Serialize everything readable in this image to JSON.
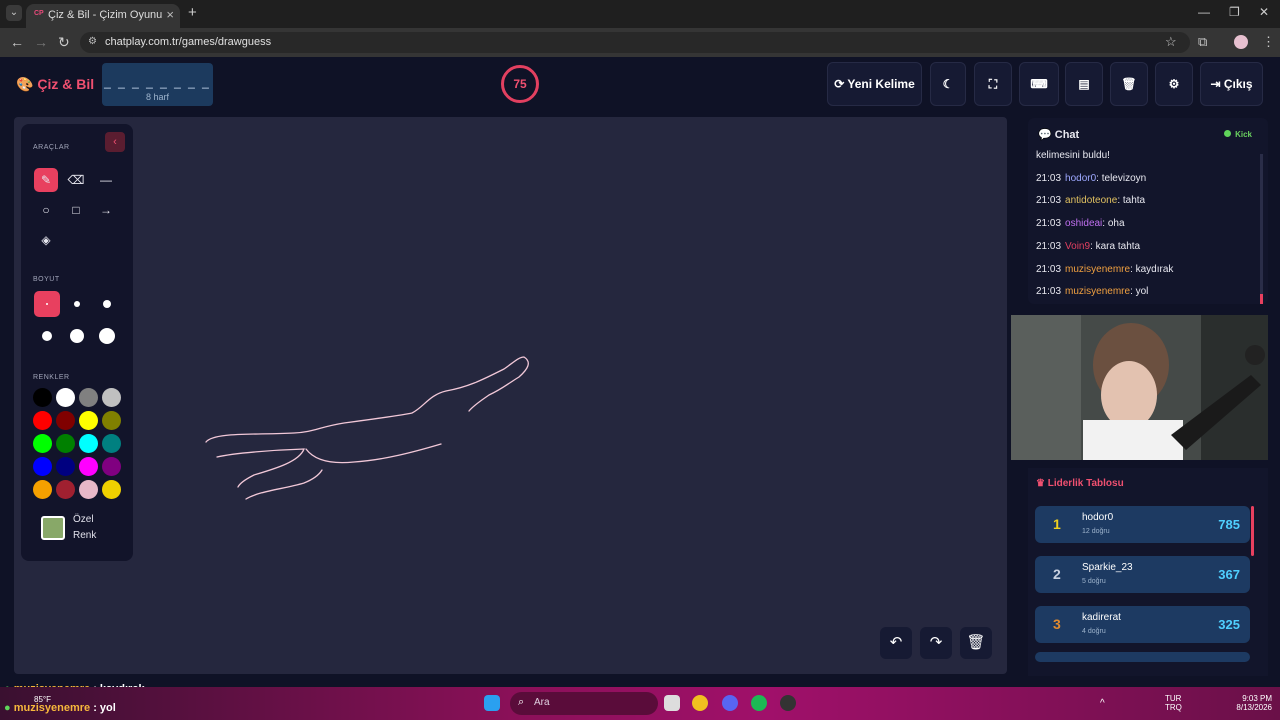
{
  "browser": {
    "tab_title": "Çiz & Bil - Çizim Oyunu",
    "tab_favicon": "CP",
    "url": "chatplay.com.tr/games/drawguess"
  },
  "header": {
    "logo": "Çiz & Bil",
    "word_dashes": "_ _ _ _ _ _ _ _",
    "word_count": "8 harf",
    "timer": "75",
    "new_word_label": "Yeni Kelime",
    "exit_label": "Çıkış"
  },
  "tools": {
    "tools_title": "ARAÇLAR",
    "size_title": "BOYUT",
    "colors_title": "RENKLER",
    "custom_color_label": "Özel Renk",
    "palette": [
      "#000000",
      "#ffffff",
      "#808080",
      "#c0c0c0",
      "#ff0000",
      "#800000",
      "#ffff00",
      "#808000",
      "#00ff00",
      "#008000",
      "#00ffff",
      "#008080",
      "#0000ff",
      "#000080",
      "#ff00ff",
      "#800080",
      "#f5a000",
      "#a02030",
      "#e8b8c8",
      "#f0d000"
    ]
  },
  "chat": {
    "title": "Chat",
    "platform": "Kick",
    "messages": [
      {
        "time": "",
        "user": "",
        "text": "kelimesini buldu!",
        "color": "#e8e8f0"
      },
      {
        "time": "21:03",
        "user": "hodor0",
        "text": ": televizoyn",
        "color": "#9da8ff"
      },
      {
        "time": "21:03",
        "user": "antidoteone",
        "text": ": tahta",
        "color": "#e0c060"
      },
      {
        "time": "21:03",
        "user": "oshideai",
        "text": ": oha",
        "color": "#c070f0"
      },
      {
        "time": "21:03",
        "user": "Voin9",
        "text": ": kara tahta",
        "color": "#e04060"
      },
      {
        "time": "21:03",
        "user": "muzisyenemre",
        "text": ": kaydırak",
        "color": "#f0a040"
      },
      {
        "time": "21:03",
        "user": "muzisyenemre",
        "text": ": yol",
        "color": "#f0a040"
      }
    ]
  },
  "leaderboard": {
    "title": "Liderlik Tablosu",
    "rows": [
      {
        "rank": "1",
        "name": "hodor0",
        "sub": "12 doğru",
        "score": "785",
        "rank_color": "#f0d020"
      },
      {
        "rank": "2",
        "name": "Sparkie_23",
        "sub": "5 doğru",
        "score": "367",
        "rank_color": "#c8d0e0"
      },
      {
        "rank": "3",
        "name": "kadirerat",
        "sub": "4 doğru",
        "score": "325",
        "rank_color": "#e08a30"
      }
    ]
  },
  "overlay": {
    "line1_user": "muzisyenemre",
    "line1_text": " : kaydırak",
    "line2_user": "muzisyenemre",
    "line2_text": " : yol",
    "weather": "85°F"
  },
  "taskbar": {
    "search": "Ara",
    "lang1": "TUR",
    "lang2": "TRQ",
    "time": "9:03 PM",
    "date": "8/13/2026"
  }
}
